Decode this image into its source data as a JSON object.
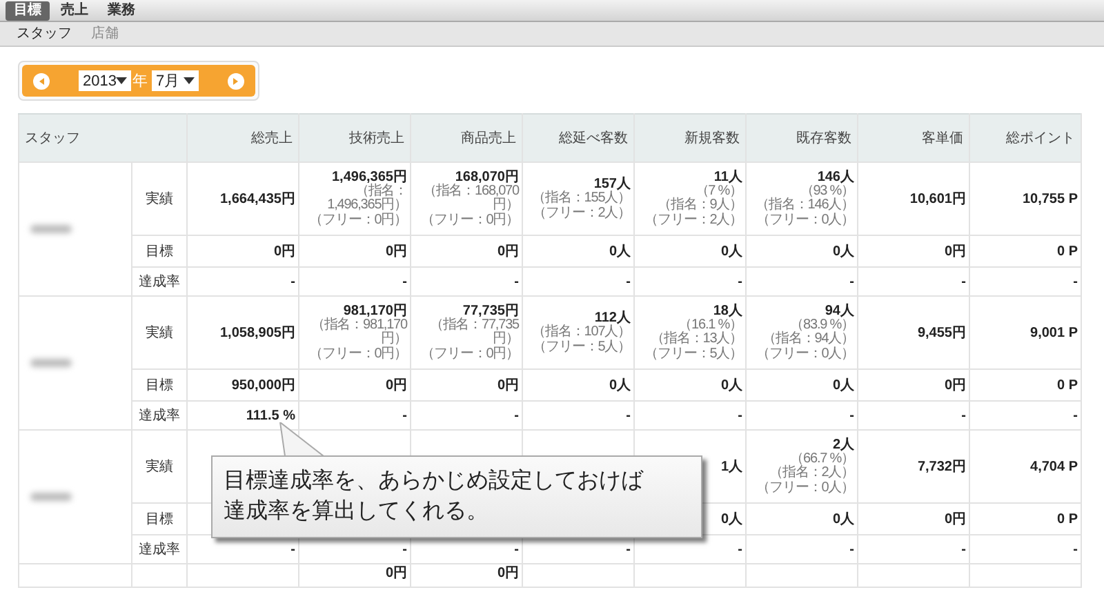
{
  "nav": {
    "tabs": [
      {
        "label": "目標",
        "selected": true
      },
      {
        "label": "売上",
        "selected": false
      },
      {
        "label": "業務",
        "selected": false
      }
    ]
  },
  "subnav": {
    "tabs": [
      {
        "label": "スタッフ",
        "selected": true
      },
      {
        "label": "店舗",
        "selected": false
      }
    ]
  },
  "period": {
    "year": "2013",
    "year_unit": "年",
    "month": "7月"
  },
  "table": {
    "staff_header": "スタッフ",
    "columns": [
      "総売上",
      "技術売上",
      "商品売上",
      "総延べ客数",
      "新規客数",
      "既存客数",
      "客単価",
      "総ポイント"
    ],
    "groups": [
      {
        "name_blurred": true,
        "rows": [
          {
            "label": "実績",
            "cells": [
              [
                "1,664,435円"
              ],
              [
                "1,496,365円",
                "（指名：1,496,365円）",
                "（フリー：0円）"
              ],
              [
                "168,070円",
                "（指名：168,070円）",
                "（フリー：0円）"
              ],
              [
                "157人",
                "（指名：155人）",
                "（フリー：2人）"
              ],
              [
                "11人",
                "（7 %）",
                "（指名：9人）",
                "（フリー：2人）"
              ],
              [
                "146人",
                "（93 %）",
                "（指名：146人）",
                "（フリー：0人）"
              ],
              [
                "10,601円"
              ],
              [
                "10,755 P"
              ]
            ]
          },
          {
            "label": "目標",
            "cells": [
              [
                "0円"
              ],
              [
                "0円"
              ],
              [
                "0円"
              ],
              [
                "0人"
              ],
              [
                "0人"
              ],
              [
                "0人"
              ],
              [
                "0円"
              ],
              [
                "0 P"
              ]
            ]
          },
          {
            "label": "達成率",
            "cells": [
              [
                "-"
              ],
              [
                "-"
              ],
              [
                "-"
              ],
              [
                "-"
              ],
              [
                "-"
              ],
              [
                "-"
              ],
              [
                "-"
              ],
              [
                "-"
              ]
            ]
          }
        ]
      },
      {
        "name_blurred": true,
        "rows": [
          {
            "label": "実績",
            "cells": [
              [
                "1,058,905円"
              ],
              [
                "981,170円",
                "（指名：981,170円）",
                "（フリー：0円）"
              ],
              [
                "77,735円",
                "（指名：77,735円）",
                "（フリー：0円）"
              ],
              [
                "112人",
                "（指名：107人）",
                "（フリー：5人）"
              ],
              [
                "18人",
                "（16.1 %）",
                "（指名：13人）",
                "（フリー：5人）"
              ],
              [
                "94人",
                "（83.9 %）",
                "（指名：94人）",
                "（フリー：0人）"
              ],
              [
                "9,455円"
              ],
              [
                "9,001 P"
              ]
            ]
          },
          {
            "label": "目標",
            "cells": [
              [
                "950,000円"
              ],
              [
                "0円"
              ],
              [
                "0円"
              ],
              [
                "0人"
              ],
              [
                "0人"
              ],
              [
                "0人"
              ],
              [
                "0円"
              ],
              [
                "0 P"
              ]
            ]
          },
          {
            "label": "達成率",
            "cells": [
              [
                "111.5 %"
              ],
              [
                "-"
              ],
              [
                "-"
              ],
              [
                "-"
              ],
              [
                "-"
              ],
              [
                "-"
              ],
              [
                "-"
              ],
              [
                "-"
              ]
            ]
          }
        ]
      },
      {
        "name_blurred": true,
        "rows": [
          {
            "label": "実績",
            "cells": [
              null,
              null,
              null,
              null,
              [
                "1人"
              ],
              [
                "2人",
                "（66.7 %）",
                "（指名：2人）",
                "（フリー：0人）"
              ],
              [
                "7,732円"
              ],
              [
                "4,704 P"
              ]
            ]
          },
          {
            "label": "目標",
            "cells": [
              null,
              null,
              null,
              null,
              [
                "0人"
              ],
              [
                "0人"
              ],
              [
                "0円"
              ],
              [
                "0 P"
              ]
            ]
          },
          {
            "label": "達成率",
            "cells": [
              [
                "-"
              ],
              [
                "-"
              ],
              [
                "-"
              ],
              [
                "-"
              ],
              [
                "-"
              ],
              [
                "-"
              ],
              [
                "-"
              ],
              [
                "-"
              ]
            ]
          }
        ]
      },
      {
        "rows": [
          {
            "cells": [
              null,
              [
                "0円"
              ],
              [
                "0円"
              ],
              null,
              null,
              null,
              null,
              null
            ]
          }
        ]
      }
    ]
  },
  "callout": {
    "lines": [
      "目標達成率を、あらかじめ設定しておけば",
      "達成率を算出してくれる。"
    ]
  }
}
